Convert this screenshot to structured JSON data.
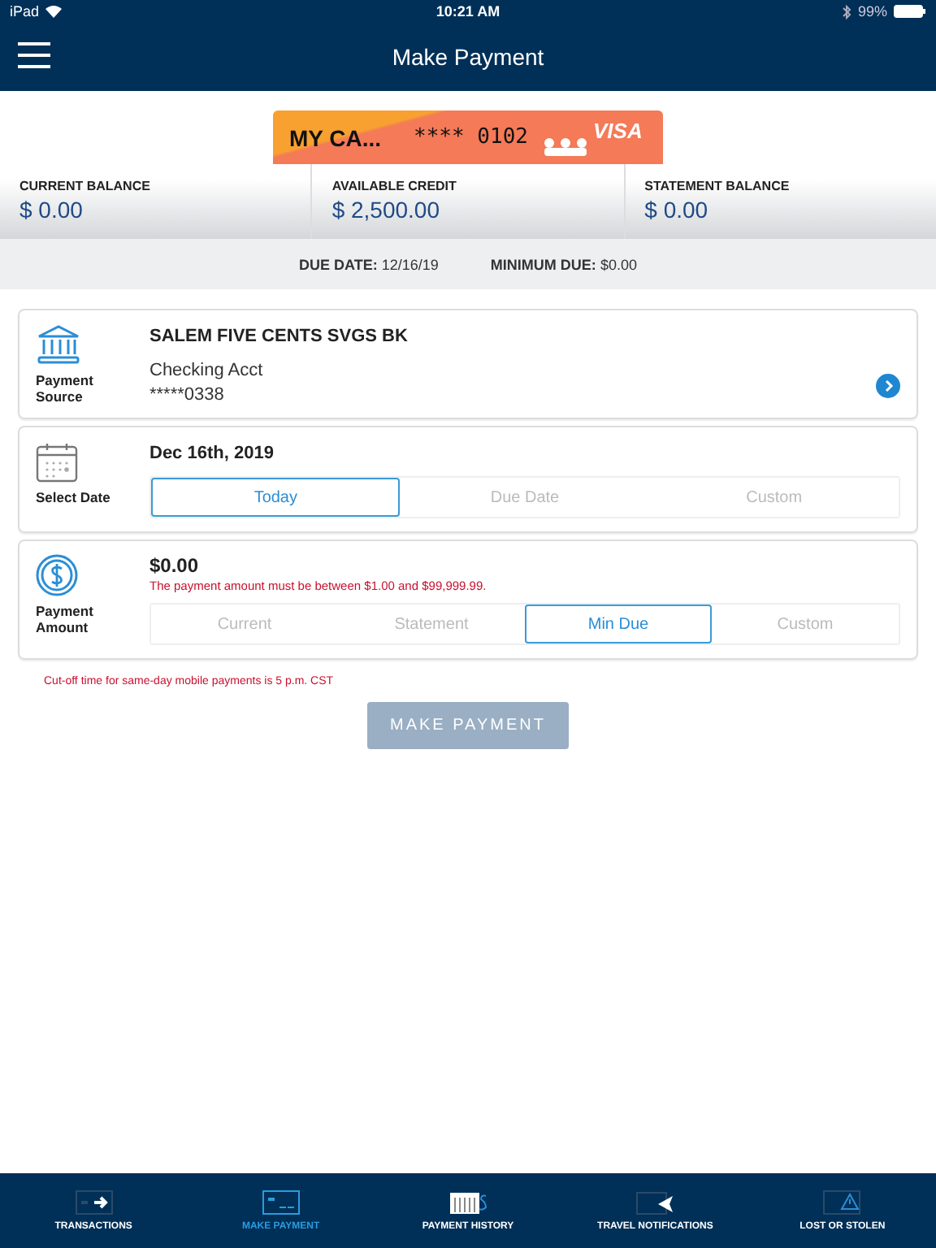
{
  "status_bar": {
    "device": "iPad",
    "time": "10:21 AM",
    "battery": "99%"
  },
  "header": {
    "title": "Make Payment"
  },
  "card": {
    "name": "MY CA...",
    "number": "**** 0102",
    "network": "VISA"
  },
  "balances": [
    {
      "label": "CURRENT BALANCE",
      "value": "$ 0.00"
    },
    {
      "label": "AVAILABLE CREDIT",
      "value": "$ 2,500.00"
    },
    {
      "label": "STATEMENT BALANCE",
      "value": "$ 0.00"
    }
  ],
  "due": {
    "date_label": "DUE DATE:",
    "date": "12/16/19",
    "min_label": "MINIMUM DUE:",
    "min": "$0.00"
  },
  "source": {
    "label": "Payment Source",
    "bank": "SALEM FIVE CENTS SVGS BK",
    "account": "Checking Acct",
    "number": "*****0338"
  },
  "date": {
    "label": "Select Date",
    "value": "Dec 16th, 2019",
    "options": [
      {
        "label": "Today",
        "selected": true
      },
      {
        "label": "Due Date",
        "selected": false
      },
      {
        "label": "Custom",
        "selected": false
      }
    ]
  },
  "amount": {
    "label": "Payment Amount",
    "value": "$0.00",
    "error": "The payment amount must be between $1.00 and $99,999.99.",
    "options": [
      {
        "label": "Current",
        "selected": false
      },
      {
        "label": "Statement",
        "selected": false
      },
      {
        "label": "Min Due",
        "selected": true
      },
      {
        "label": "Custom",
        "selected": false
      }
    ]
  },
  "cutoff_note": "Cut-off time for same-day mobile payments is 5 p.m. CST",
  "submit": {
    "label": "MAKE PAYMENT",
    "disabled": true
  },
  "tab_bar": [
    {
      "label": "TRANSACTIONS",
      "kind": "transactions",
      "selected": false
    },
    {
      "label": "MAKE PAYMENT",
      "kind": "payment",
      "selected": true
    },
    {
      "label": "PAYMENT HISTORY",
      "kind": "history",
      "selected": false
    },
    {
      "label": "TRAVEL NOTIFICATIONS",
      "kind": "travel",
      "selected": false
    },
    {
      "label": "LOST OR STOLEN",
      "kind": "lost",
      "selected": false
    }
  ]
}
